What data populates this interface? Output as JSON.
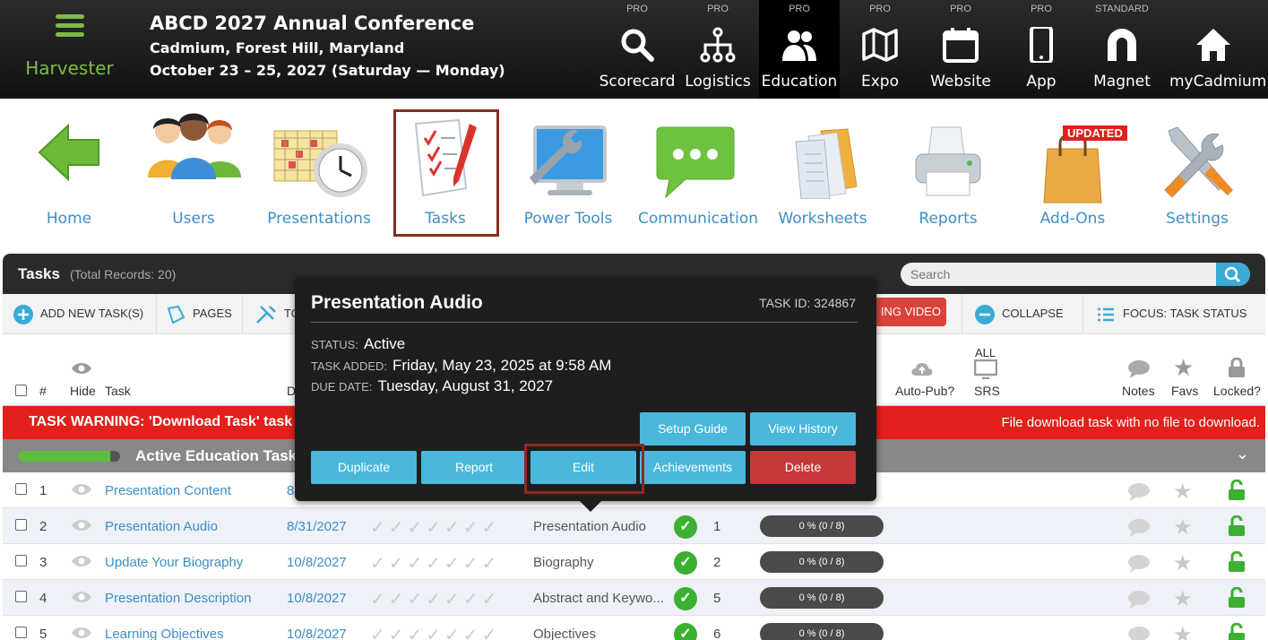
{
  "app": {
    "name": "Harvester"
  },
  "conference": {
    "title": "ABCD 2027 Annual Conference",
    "location": "Cadmium, Forest Hill, Maryland",
    "dates": "October 23 – 25, 2027 (Saturday — Monday)"
  },
  "top_modules": [
    {
      "tier": "PRO",
      "label": "Scorecard",
      "icon": "search-icon"
    },
    {
      "tier": "PRO",
      "label": "Logistics",
      "icon": "network-icon"
    },
    {
      "tier": "PRO",
      "label": "Education",
      "icon": "users-icon",
      "active": true
    },
    {
      "tier": "PRO",
      "label": "Expo",
      "icon": "map-icon"
    },
    {
      "tier": "PRO",
      "label": "Website",
      "icon": "calendar-icon"
    },
    {
      "tier": "PRO",
      "label": "App",
      "icon": "phone-icon"
    },
    {
      "tier": "STANDARD",
      "label": "Magnet",
      "icon": "magnet-icon"
    },
    {
      "tier": "",
      "label": "myCadmium",
      "icon": "home-icon"
    }
  ],
  "nav_icons": [
    {
      "label": "Home"
    },
    {
      "label": "Users"
    },
    {
      "label": "Presentations"
    },
    {
      "label": "Tasks"
    },
    {
      "label": "Power Tools"
    },
    {
      "label": "Communication"
    },
    {
      "label": "Worksheets"
    },
    {
      "label": "Reports"
    },
    {
      "label": "Add-Ons",
      "badge": "UPDATED"
    },
    {
      "label": "Settings"
    }
  ],
  "panel": {
    "title": "Tasks",
    "total": "(Total Records: 20)",
    "search_placeholder": "Search"
  },
  "toolbar": {
    "add": "ADD NEW TASK(S)",
    "pages": "PAGES",
    "tools": "TO",
    "video": "ING VIDEO",
    "collapse": "COLLAPSE ALL",
    "focus": "FOCUS: TASK STATUS"
  },
  "columns": {
    "check": "",
    "num": "#",
    "hide": "Hide",
    "task": "Task",
    "due": "D",
    "autopub": "Auto-Pub?",
    "srs": "SRS",
    "notes": "Notes",
    "favs": "Favs",
    "locked": "Locked?"
  },
  "warning": {
    "left": "TASK WARNING: 'Download Task' task ('",
    "right": "File download task with no file to download."
  },
  "group": {
    "label": "Active Education Tasks",
    "progress": 0.9
  },
  "rows": [
    {
      "num": "1",
      "task": "Presentation Content",
      "due": "8/",
      "page": "",
      "order": "",
      "progress": ""
    },
    {
      "num": "2",
      "task": "Presentation Audio",
      "due": "8/31/2027",
      "page": "Presentation Audio",
      "order": "1",
      "progress": "0 % (0 / 8)"
    },
    {
      "num": "3",
      "task": "Update Your Biography",
      "due": "10/8/2027",
      "page": "Biography",
      "order": "2",
      "progress": "0 % (0 / 8)"
    },
    {
      "num": "4",
      "task": "Presentation Description",
      "due": "10/8/2027",
      "page": "Abstract and Keywo...",
      "order": "5",
      "progress": "0 % (0 / 8)"
    },
    {
      "num": "5",
      "task": "Learning Objectives",
      "due": "10/8/2027",
      "page": "Objectives",
      "order": "6",
      "progress": "0 % (0 / 8)"
    }
  ],
  "popup": {
    "title": "Presentation Audio",
    "task_id": "TASK ID: 324867",
    "status_label": "STATUS:",
    "status": "Active",
    "added_label": "TASK ADDED:",
    "added": "Friday, May 23, 2025 at 9:58 AM",
    "due_label": "DUE DATE:",
    "due": "Tuesday, August 31, 2027",
    "buttons": {
      "setup": "Setup Guide",
      "history": "View History",
      "duplicate": "Duplicate",
      "report": "Report",
      "edit": "Edit",
      "achievements": "Achievements",
      "delete": "Delete"
    }
  }
}
